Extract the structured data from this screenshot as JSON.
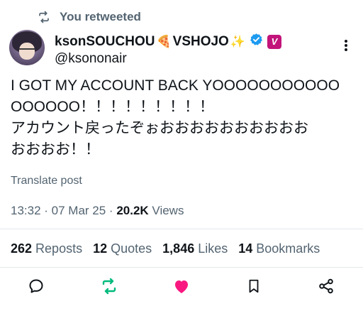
{
  "retweet": {
    "label": "You retweeted",
    "icon": "retweet-icon"
  },
  "author": {
    "display_name": "ksonSOUCHOU",
    "emoji_pizza": "🍕",
    "display_name_2": "VSHOJO",
    "emoji_sparkles": "✨",
    "handle": "@ksononair",
    "badge_letter": "V"
  },
  "tweet": {
    "lines": [
      "I GOT MY ACCOUNT BACK YOOOOOOOOOOO",
      "OOOOOO！！！！！！！！！",
      "アカウント戻ったぞぉおおおおおおおおおお",
      "おおおお！！"
    ],
    "translate": "Translate post",
    "time": "13:32 · 07 Mar 25 · ",
    "views_count": "20.2K",
    "views_label": " Views"
  },
  "stats": [
    {
      "count": "262",
      "label": "Reposts"
    },
    {
      "count": "12",
      "label": "Quotes"
    },
    {
      "count": "1,846",
      "label": "Likes"
    },
    {
      "count": "14",
      "label": "Bookmarks"
    }
  ],
  "colors": {
    "retweet_green": "#00ba7c",
    "like_pink": "#f91880",
    "verified_blue": "#1d9bf0",
    "badge_magenta": "#c2147a",
    "secondary_text": "#536471"
  }
}
